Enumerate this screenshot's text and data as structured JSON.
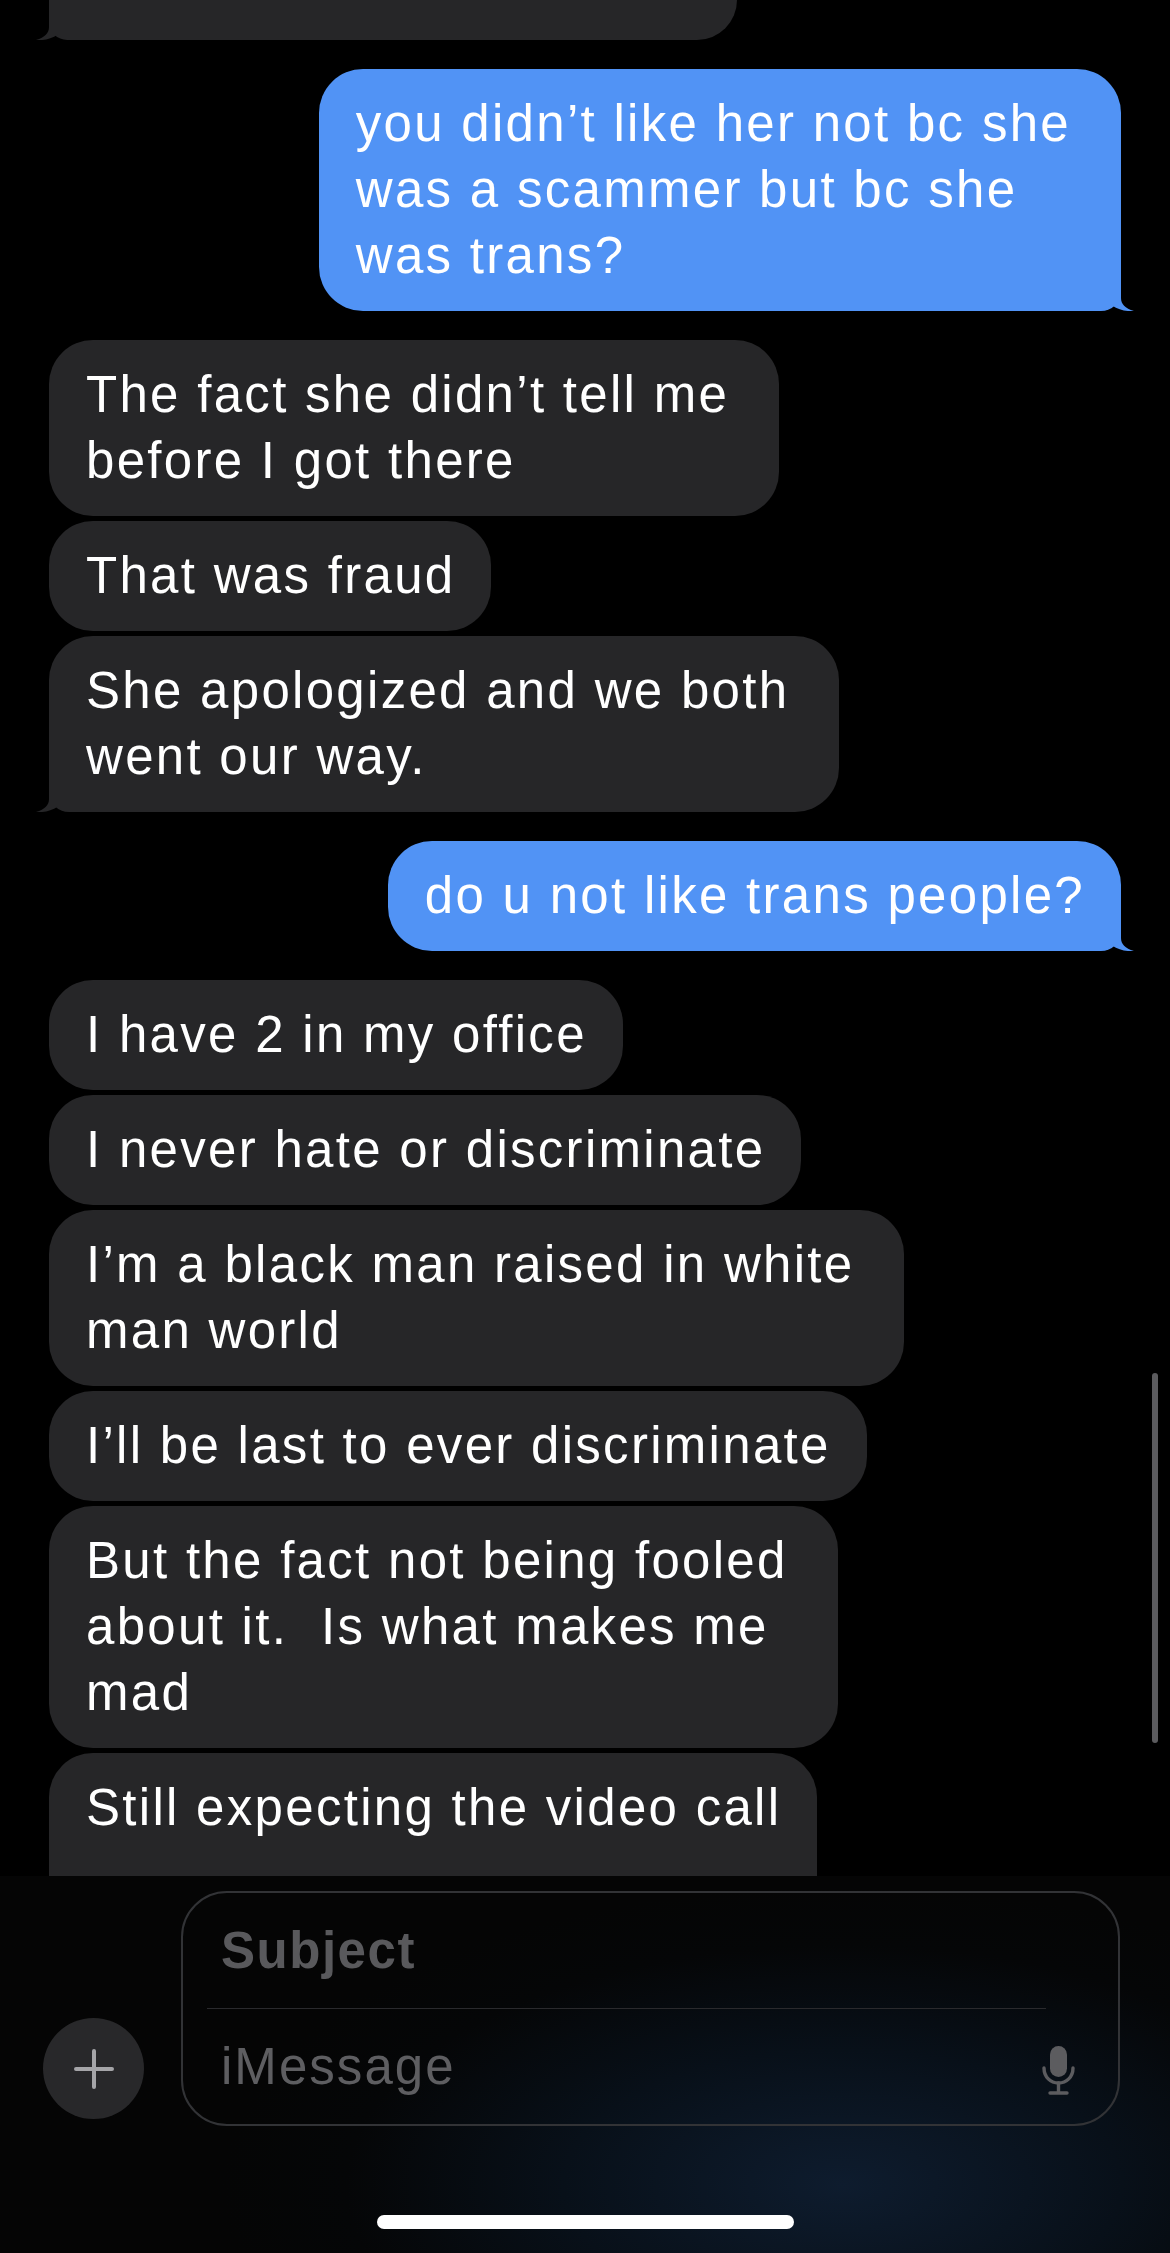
{
  "conversation": {
    "messages": [
      {
        "kind": "received",
        "tail": true,
        "cut_off": true
      },
      {
        "kind": "sent",
        "lines": [
          "you didn’t like her not bc she",
          "was a scammer but bc she",
          "was trans?"
        ],
        "tail": true,
        "cut_off": false
      },
      {
        "kind": "received",
        "lines": [
          "The fact she didn’t tell me",
          "before I got there"
        ],
        "tail": false,
        "cut_off": false
      },
      {
        "kind": "received",
        "lines": [
          "That was fraud"
        ],
        "tail": false,
        "cut_off": false
      },
      {
        "kind": "received",
        "lines": [
          "She apologized and we both",
          "went our way."
        ],
        "tail": true,
        "cut_off": false
      },
      {
        "kind": "sent",
        "lines": [
          "do u not like trans people?"
        ],
        "tail": true,
        "cut_off": false
      },
      {
        "kind": "received",
        "lines": [
          "I have 2 in my office"
        ],
        "tail": false,
        "cut_off": false
      },
      {
        "kind": "received",
        "lines": [
          "I never hate or discriminate"
        ],
        "tail": false,
        "cut_off": false
      },
      {
        "kind": "received",
        "lines": [
          "I’m a black man raised in white",
          "man world"
        ],
        "tail": false,
        "cut_off": false
      },
      {
        "kind": "received",
        "lines": [
          "I’ll be last to ever discriminate"
        ],
        "tail": false,
        "cut_off": false
      },
      {
        "kind": "received",
        "lines": [
          "But the fact not being fooled",
          "about it.  Is what makes me",
          "mad"
        ],
        "tail": false,
        "cut_off": false
      },
      {
        "kind": "received",
        "lines": [
          "Still expecting the video call"
        ],
        "tail": false,
        "cut_off": true
      }
    ]
  },
  "composer": {
    "subject": {
      "placeholder": "Subject"
    },
    "message": {
      "placeholder": "iMessage"
    }
  }
}
